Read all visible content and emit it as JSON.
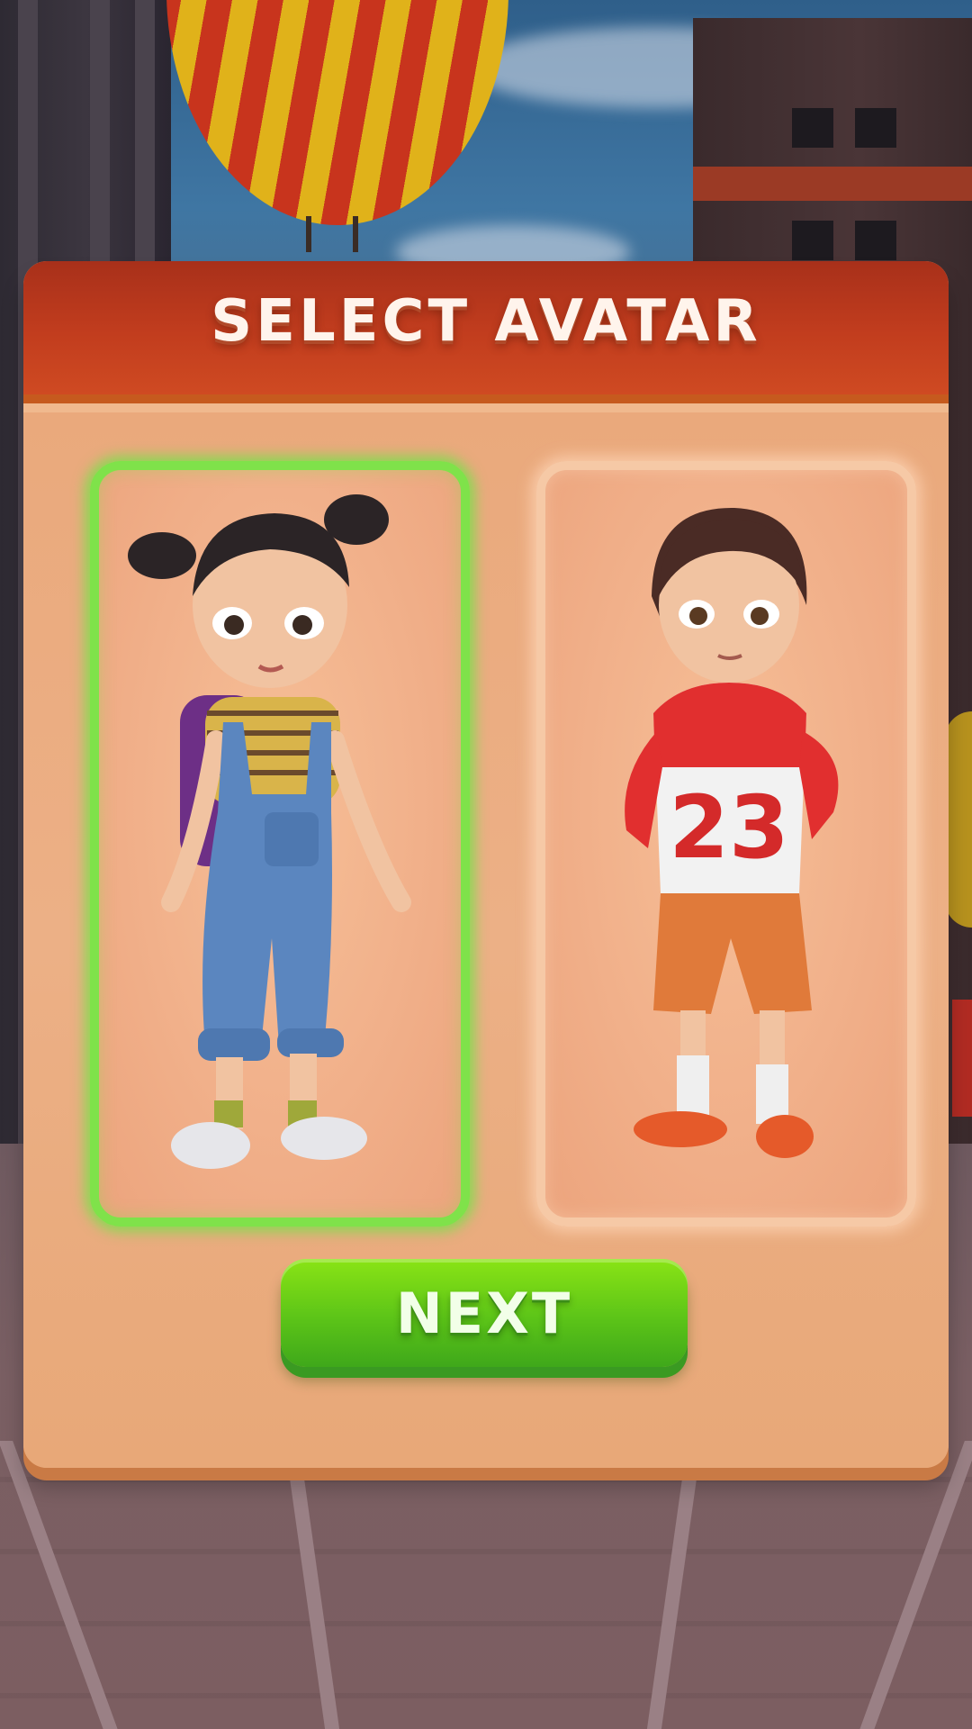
{
  "dialog": {
    "title": "SELECT AVATAR"
  },
  "avatars": [
    {
      "id": "girl",
      "selected": true
    },
    {
      "id": "boy",
      "selected": false,
      "jersey_number": "23"
    }
  ],
  "next_button": {
    "label": "NEXT"
  },
  "colors": {
    "header": "#c23d1e",
    "panel": "#e9aa7c",
    "selected_glow": "#7fe24a",
    "button": "#5cc418"
  }
}
